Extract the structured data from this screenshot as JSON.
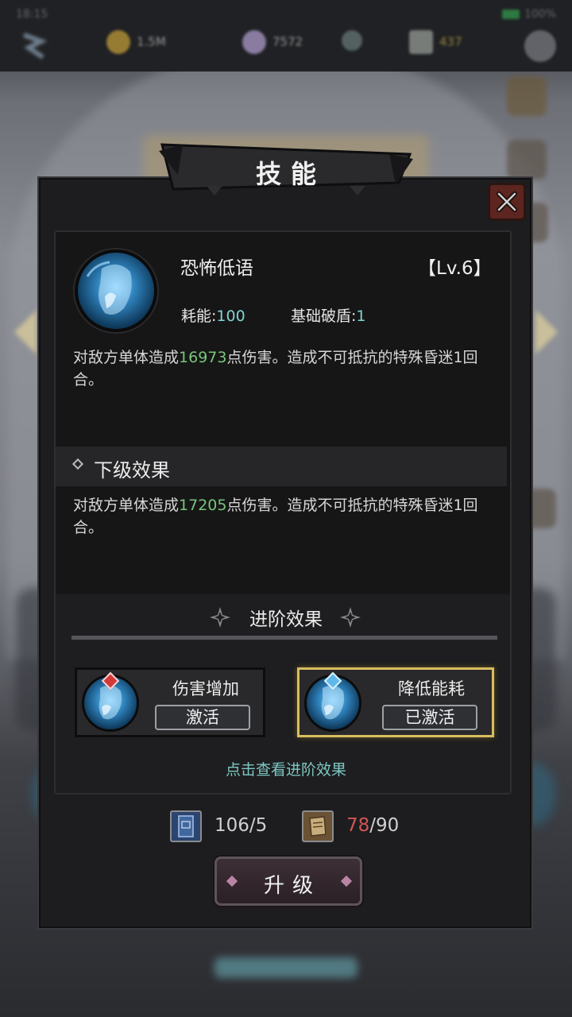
{
  "status_bar": {
    "left": "18:15",
    "battery": "100%"
  },
  "resources": {
    "gold": "1.5M",
    "gems": "7572",
    "energy": "437"
  },
  "panel": {
    "title": "技能",
    "close_icon": "close-icon"
  },
  "skill": {
    "name": "恐怖低语",
    "level": "【Lv.6】",
    "cost_label": "耗能:",
    "cost_value": "100",
    "break_label": "基础破盾:",
    "break_value": "1",
    "desc_pre": "对敌方单体造成",
    "desc_damage": "16973",
    "desc_post": "点伤害。造成不可抵抗的特殊昏迷1回合。"
  },
  "next_level": {
    "heading": "下级效果",
    "desc_pre": "对敌方单体造成",
    "desc_damage": "17205",
    "desc_post": "点伤害。造成不可抵抗的特殊昏迷1回合。"
  },
  "advanced": {
    "heading": "进阶效果",
    "options": [
      {
        "name": "伤害增加",
        "button": "激活",
        "gem_color": "#d23a3a",
        "active": false
      },
      {
        "name": "降低能耗",
        "button": "已激活",
        "gem_color": "#5fb8ea",
        "active": true
      }
    ],
    "hint": "点击查看进阶效果"
  },
  "costs": {
    "book_owned": "106",
    "book_sep": "/",
    "book_need": "5",
    "scroll_owned": "78",
    "scroll_sep": "/",
    "scroll_need": "90"
  },
  "upgrade_button": "升级",
  "colors": {
    "accent_teal": "#7cc8c2",
    "damage_green": "#79c57a",
    "insufficient_red": "#d05555",
    "active_gold": "#d8bd5f"
  }
}
